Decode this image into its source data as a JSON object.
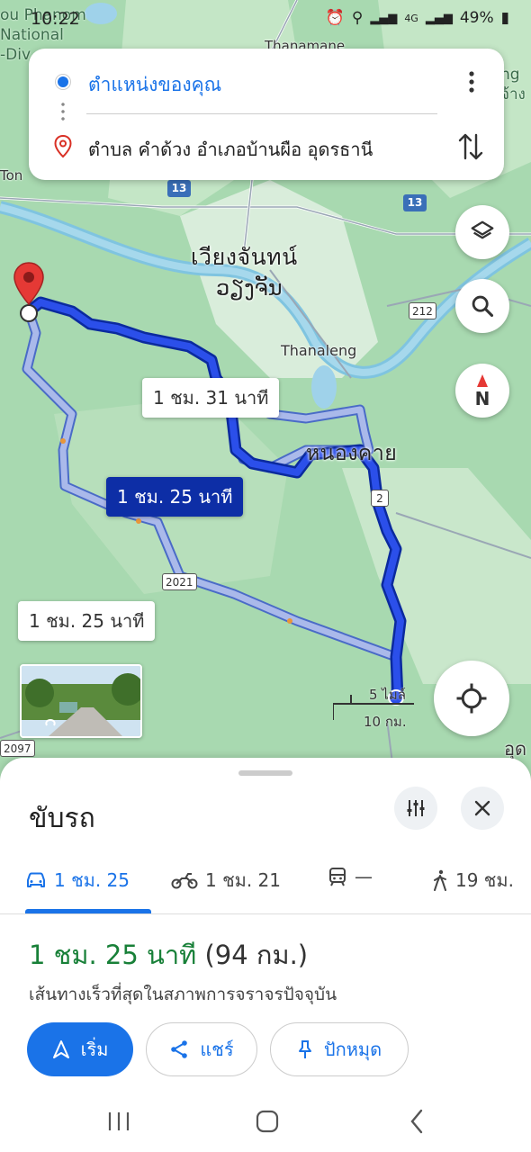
{
  "status_bar": {
    "time": "10:22",
    "battery": "49%",
    "network": "4G"
  },
  "map": {
    "corner_labels": [
      "ou Phanom",
      "National",
      "-Div"
    ],
    "corner_right_labels": [
      "ng",
      "จ้าง"
    ],
    "top_label": "Thanamane",
    "left_label": "Ton",
    "city_name_thai": "เวียงจันทน์",
    "city_name_lao": "ວຽງຈັນ",
    "district_label": "Thanaleng",
    "nongkhai_label": "หนองคาย",
    "bottom_right_label": "อุด",
    "shields": {
      "r13_left": "13",
      "r13_right": "13",
      "r212": "212",
      "r2": "2",
      "r2021": "2021",
      "r2097": "2097"
    },
    "scale_miles": "5 ไมล์",
    "scale_km": "10 กม."
  },
  "directions_card": {
    "origin": "ตำแหน่งของคุณ",
    "destination": "ตำบล คำด้วง อำเภอบ้านผือ อุดรธานี"
  },
  "route_labels": {
    "alt1": "1 ชม. 31 นาที",
    "selected": "1 ชม. 25 นาที",
    "alt2": "1 ชม. 25 นาที"
  },
  "sheet": {
    "title": "ขับรถ",
    "modes": [
      {
        "name": "car",
        "label": "1 ชม. 25"
      },
      {
        "name": "motorcycle",
        "label": "1 ชม. 21"
      },
      {
        "name": "transit",
        "label": "—"
      },
      {
        "name": "walk",
        "label": "19 ชม."
      }
    ],
    "duration": "1 ชม. 25 นาที",
    "distance": "(94 กม.)",
    "subtitle": "เส้นทางเร็วที่สุดในสภาพการจราจรปัจจุบัน",
    "buttons": {
      "start": "เริ่ม",
      "share": "แชร์",
      "pin": "ปักหมุด"
    }
  },
  "colors": {
    "accent": "#1a73e8",
    "route_selected": "#1a3fd6",
    "route_alt": "#9fb3e8",
    "duration_green": "#188038",
    "map_green": "#a8d9b0"
  }
}
